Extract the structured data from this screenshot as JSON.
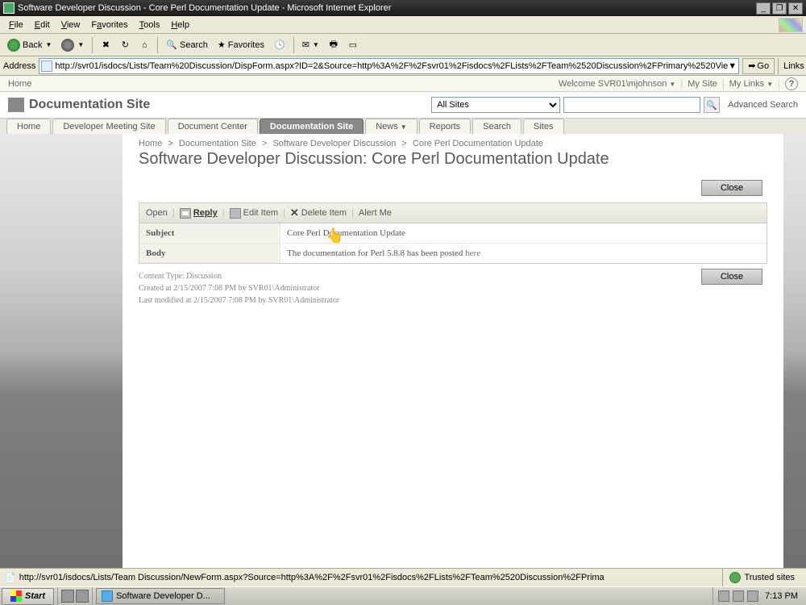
{
  "window_title": "Software Developer Discussion - Core Perl Documentation Update - Microsoft Internet Explorer",
  "menus": {
    "file": "File",
    "edit": "Edit",
    "view": "View",
    "favorites": "Favorites",
    "tools": "Tools",
    "help": "Help"
  },
  "toolbar": {
    "back": "Back",
    "search": "Search",
    "favorites": "Favorites"
  },
  "address": {
    "label": "Address",
    "url": "http://svr01/isdocs/Lists/Team%20Discussion/DispForm.aspx?ID=2&Source=http%3A%2F%2Fsvr01%2Fisdocs%2FLists%2FTeam%2520Discussion%2FPrimary%2520Vie",
    "go": "Go",
    "links": "Links"
  },
  "sp_strip": {
    "home": "Home",
    "welcome": "Welcome SVR01\\mjohnson",
    "mysite": "My Site",
    "mylinks": "My Links"
  },
  "site": {
    "title": "Documentation Site",
    "scope": "All Sites",
    "advanced": "Advanced Search"
  },
  "tabs": {
    "home": "Home",
    "dev": "Developer Meeting Site",
    "doccenter": "Document Center",
    "docsite": "Documentation Site",
    "news": "News",
    "reports": "Reports",
    "search": "Search",
    "sites": "Sites"
  },
  "breadcrumb": {
    "home": "Home",
    "docsite": "Documentation Site",
    "discussion": "Software Developer Discussion",
    "item": "Core Perl Documentation Update"
  },
  "page_title": "Software Developer Discussion: Core Perl Documentation Update",
  "close_label": "Close",
  "item_toolbar": {
    "open": "Open",
    "reply": "Reply",
    "edit": "Edit Item",
    "delete": "Delete Item",
    "alert": "Alert Me"
  },
  "fields": {
    "subject_label": "Subject",
    "subject_value": "Core Perl Documentation Update",
    "body_label": "Body",
    "body_value": "The documentation for Perl 5.8.8 has been posted ",
    "body_link": "here"
  },
  "meta": {
    "content_type": "Content Type: Discussion",
    "created": "Created at 2/15/2007 7:08 PM  by SVR01\\Administrator",
    "modified": "Last modified at 2/15/2007 7:08 PM  by SVR01\\Administrator"
  },
  "statusbar": {
    "url": "http://svr01/isdocs/Lists/Team Discussion/NewForm.aspx?Source=http%3A%2F%2Fsvr01%2Fisdocs%2FLists%2FTeam%2520Discussion%2FPrima",
    "zone": "Trusted sites"
  },
  "taskbar": {
    "start": "Start",
    "task": "Software Developer D...",
    "clock": "7:13 PM"
  }
}
